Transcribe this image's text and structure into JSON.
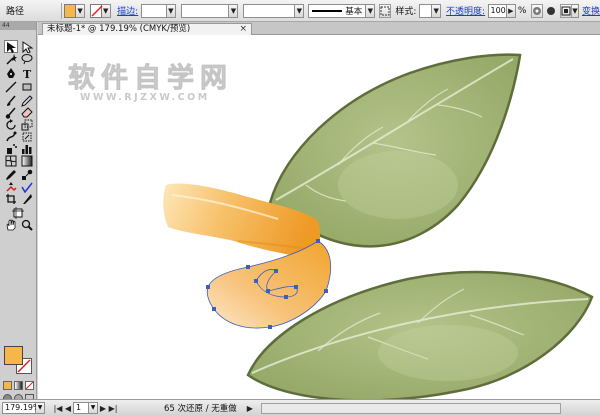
{
  "control_bar": {
    "object_type": "路径",
    "stroke_label": "描边:",
    "stroke_profile": "基本",
    "style_label": "样式:",
    "opacity_label": "不透明度:",
    "opacity_value": "100",
    "opacity_unit": "%",
    "transform_label": "变换",
    "fill_color": "#f5b64a"
  },
  "tool_panel": {
    "grip_label": "44",
    "tools": [
      "selection-tool",
      "direct-selection-tool",
      "magic-wand-tool",
      "lasso-tool",
      "pen-tool",
      "type-tool",
      "line-tool",
      "rectangle-tool",
      "paintbrush-tool",
      "pencil-tool",
      "blob-brush-tool",
      "eraser-tool",
      "rotate-tool",
      "scale-tool",
      "warp-tool",
      "free-transform-tool",
      "symbol-sprayer-tool",
      "column-graph-tool",
      "mesh-tool",
      "gradient-tool",
      "eyedropper-tool",
      "blend-tool",
      "live-paint-tool",
      "live-paint-selection-tool",
      "crop-tool",
      "slice-tool",
      "artboard-tool",
      "hand-tool",
      "zoom-tool"
    ],
    "fill_swatch": "#f5b64a"
  },
  "document": {
    "tab_title": "未标题-1* @ 179.19% (CMYK/预览)",
    "close_glyph": "×"
  },
  "watermark": {
    "title": "软件自学网",
    "url": "WWW.RJZXW.COM"
  },
  "status_bar": {
    "zoom": "179.19%",
    "page": "1",
    "history": "65 次还原 / 无重做"
  },
  "colors": {
    "leaf_fill": "#9aae6e",
    "leaf_outline": "#5b6a3a",
    "petal_orange": "#f0a030",
    "anchor_blue": "#3b5fc0"
  }
}
